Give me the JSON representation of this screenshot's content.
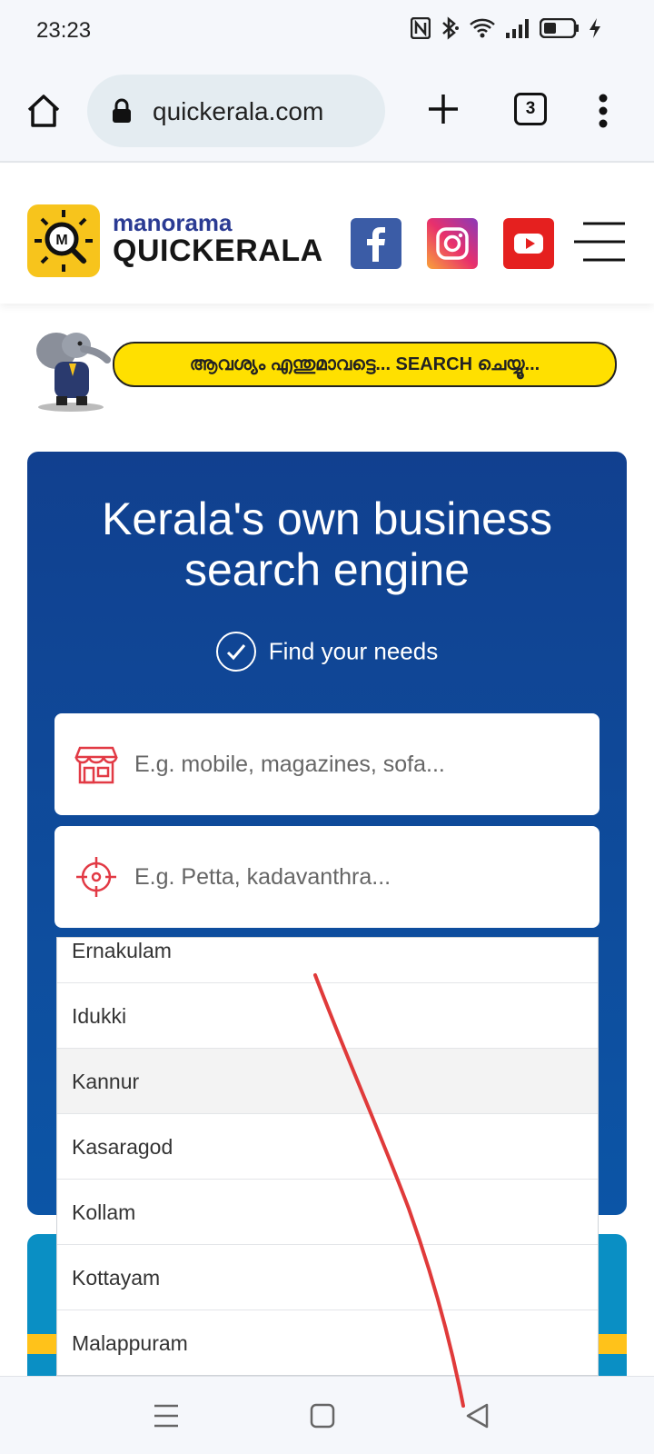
{
  "status_bar": {
    "time": "23:23",
    "icons": [
      "nfc-icon",
      "bluetooth-icon",
      "wifi-icon",
      "signal-icon",
      "battery-icon",
      "charging-icon"
    ]
  },
  "browser": {
    "url": "quickerala.com",
    "tab_count": "3",
    "icons": [
      "home-icon",
      "lock-icon",
      "plus-icon",
      "tabs-icon",
      "more-vert-icon"
    ]
  },
  "site_header": {
    "brand_top": "manorama",
    "brand_main": "QUICKERALA",
    "social": [
      "facebook-icon",
      "instagram-icon",
      "youtube-icon"
    ],
    "menu_icon": "hamburger-icon"
  },
  "banner": {
    "text": "ആവശ്യം എന്തുമാവട്ടെ... SEARCH ചെയ്യൂ..."
  },
  "hero": {
    "title_line1": "Kerala's own business",
    "title_line2": "search engine",
    "subtitle": "Find your needs",
    "search": {
      "what_placeholder": "E.g. mobile, magazines, sofa...",
      "where_placeholder": "E.g. Petta, kadavanthra..."
    }
  },
  "dropdown": {
    "items": [
      "Ernakulam",
      "Idukki",
      "Kannur",
      "Kasaragod",
      "Kollam",
      "Kottayam",
      "Malappuram"
    ],
    "highlighted": "Kannur"
  },
  "colors": {
    "hero_blue": "#11408f",
    "brand_yellow": "#f7c41c",
    "brand_navy": "#2b3b93",
    "icon_red": "#e23a45",
    "annotation_red": "#e03a3a"
  }
}
